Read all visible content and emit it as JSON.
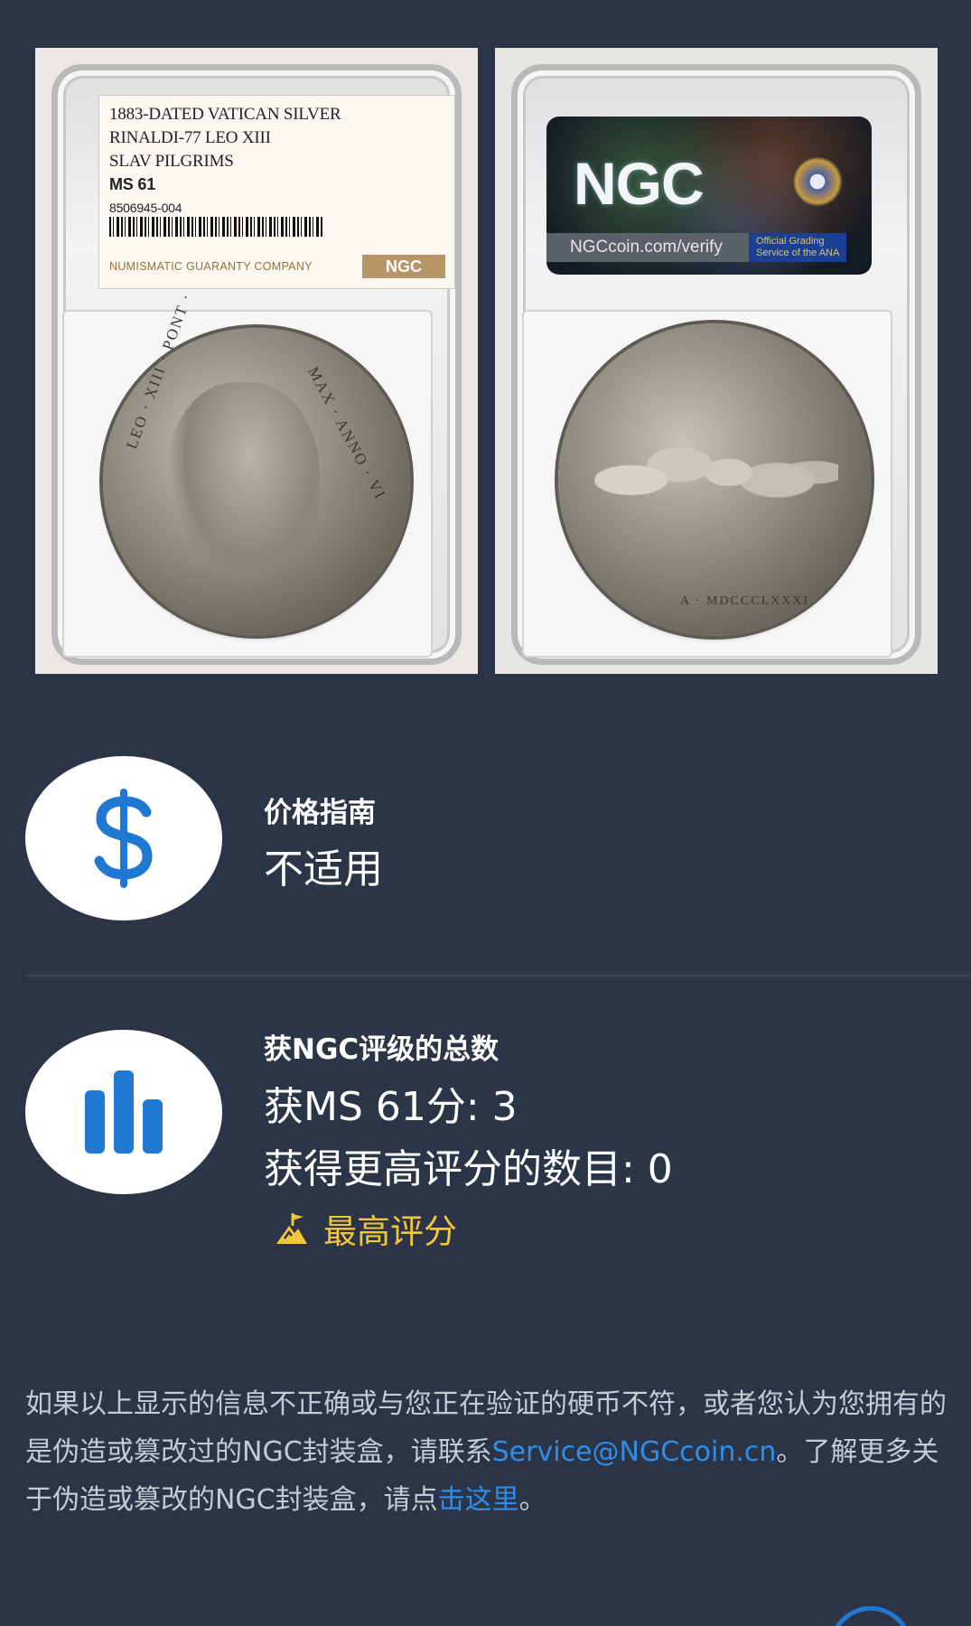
{
  "label": {
    "line1": "1883-DATED VATICAN SILVER",
    "line2": "RINALDI-77 LEO XIII",
    "line3": "SLAV PILGRIMS",
    "grade": "MS 61",
    "cert": "8506945-004",
    "company": "NUMISMATIC GUARANTY COMPANY",
    "brand": "NGC"
  },
  "obverse_legend": {
    "left": "LEO · XIII · PONT ·",
    "right": "MAX · ANNO · VI"
  },
  "reverse_legend": {
    "exergue": "A · MDCCCLXXXI"
  },
  "back_label": {
    "logo": "NGC",
    "verify_url": "NGCcoin.com/verify",
    "official": "Official Grading\nService of the ANA"
  },
  "price_guide": {
    "icon": "dollar-icon",
    "title": "价格指南",
    "value": "不适用"
  },
  "population": {
    "icon": "bar-chart-icon",
    "title": "获NGC评级的总数",
    "grade_count": "获MS 61分: 3",
    "higher_count": "获得更高评分的数目: 0",
    "top_grade_icon": "mountain-flag-icon",
    "top_grade_label": "最高评分"
  },
  "notice": {
    "text1": "如果以上显示的信息不正确或与您正在验证的硬币不符，或者您认为您拥有的是伪造或篡改过的NGC封装盒，请联系",
    "email": "Service@NGCcoin.cn",
    "text2": "。了解更多关于伪造或篡改的NGC封装盒，请点",
    "link": "击这里",
    "text3": "。"
  },
  "colors": {
    "background": "#2b3547",
    "accent_blue": "#1f78d1",
    "gold": "#f2c63a",
    "link": "#2f8ee8"
  }
}
